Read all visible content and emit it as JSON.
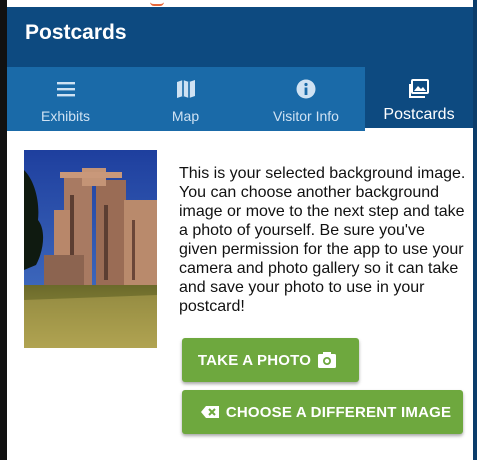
{
  "app": {
    "title": "Postcards"
  },
  "tabs": [
    {
      "label": "Exhibits",
      "icon": "menu-icon",
      "active": false
    },
    {
      "label": "Map",
      "icon": "map-icon",
      "active": false
    },
    {
      "label": "Visitor Info",
      "icon": "info-icon",
      "active": false
    },
    {
      "label": "Postcards",
      "icon": "photo-gallery-icon",
      "active": true
    }
  ],
  "content": {
    "description": "This is your selected background image. You can choose another background image or move to the next step and take a photo of yourself. Be sure you've given permission for the app to use your camera and photo gallery so it can take and save your photo to use in your postcard!",
    "take_photo_label": "TAKE A PHOTO",
    "choose_image_label": "CHOOSE A DIFFERENT IMAGE"
  },
  "colors": {
    "appbar": "#0d4a80",
    "tabbar": "#1a6aa8",
    "button": "#6ea83e"
  }
}
